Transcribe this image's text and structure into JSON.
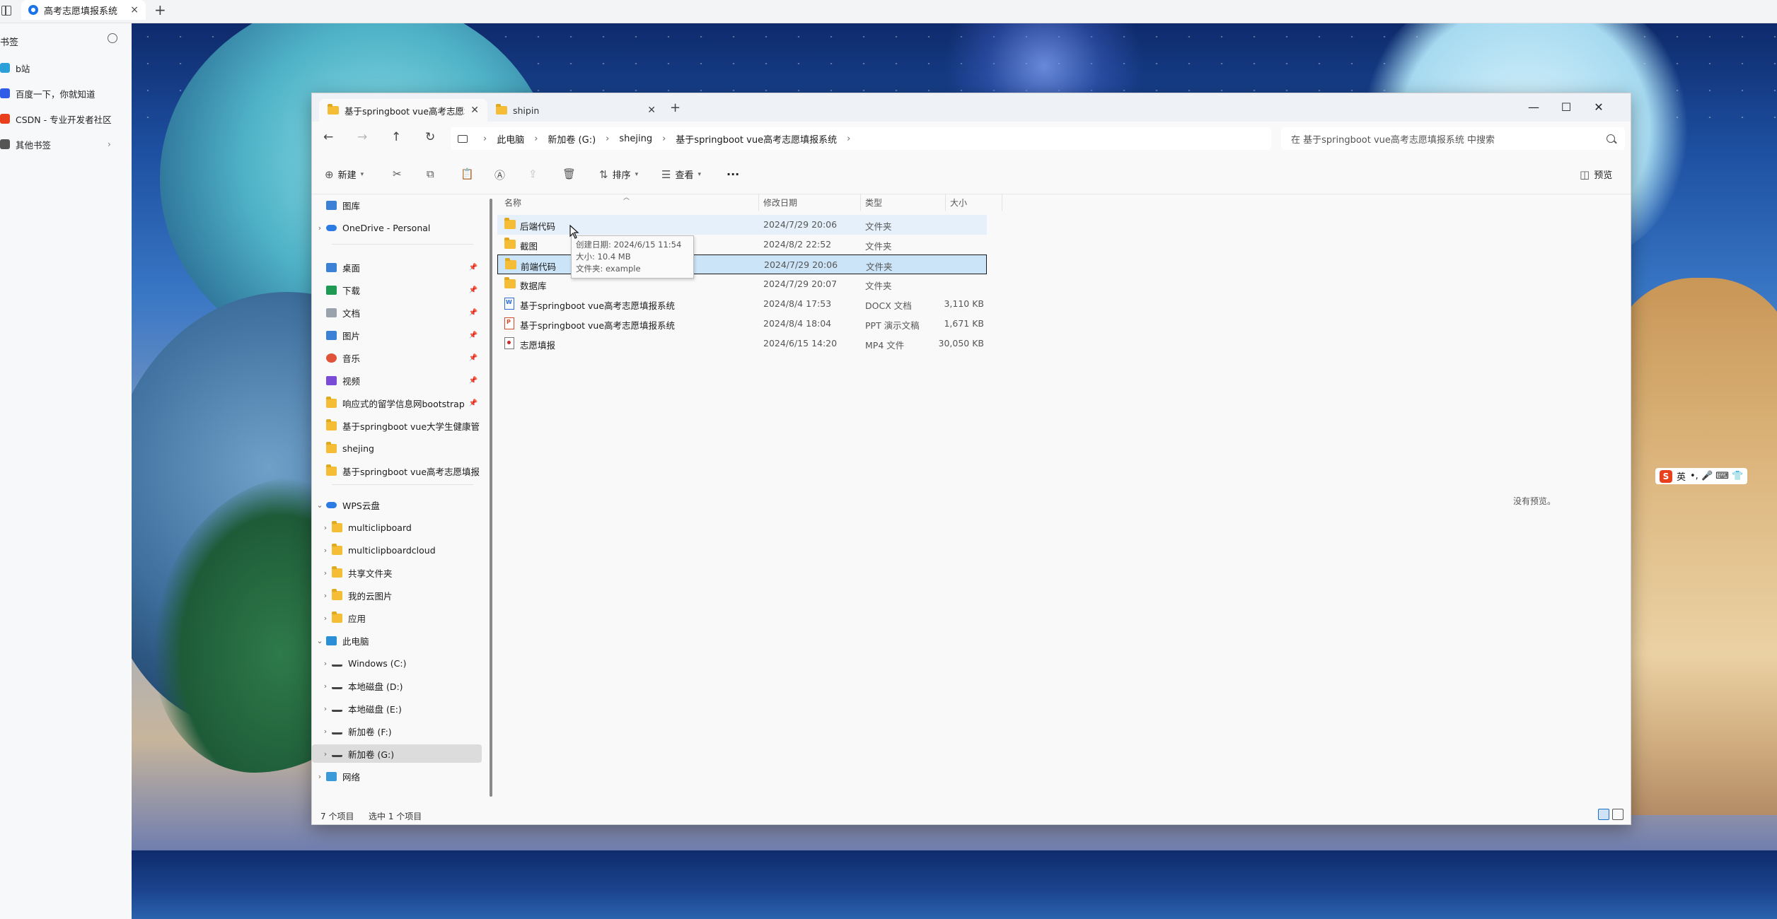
{
  "browser": {
    "tab_title": "高考志愿填报系统",
    "new_tab": "+",
    "tab_close": "×"
  },
  "bookmarks": {
    "header": "书签",
    "items": [
      {
        "label": "b站",
        "icon": "bilibili-icon",
        "color": "#2a9fd8"
      },
      {
        "label": "百度一下，你就知道",
        "icon": "baidu-icon",
        "color": "#2f5ce6"
      },
      {
        "label": "CSDN - 专业开发者社区",
        "icon": "csdn-icon",
        "color": "#e8401c"
      },
      {
        "label": "其他书签",
        "icon": "folder-icon",
        "color": "#555555"
      }
    ]
  },
  "explorer": {
    "tabs": [
      {
        "label": "基于springboot vue高考志愿填"
      },
      {
        "label": "shipin"
      }
    ],
    "window_controls": {
      "minimize": "—",
      "maximize": "☐",
      "close": "✕"
    },
    "breadcrumb": [
      "此电脑",
      "新加卷 (G:)",
      "shejing",
      "基于springboot vue高考志愿填报系统"
    ],
    "search_placeholder": "在 基于springboot vue高考志愿填报系统 中搜索",
    "commands": {
      "new": "新建",
      "sort": "排序",
      "view": "查看",
      "more": "···",
      "preview": "预览"
    },
    "nav_pane": [
      {
        "label": "图库",
        "icon": "gallery-icon",
        "kind": "blue",
        "chev": ""
      },
      {
        "label": "OneDrive - Personal",
        "icon": "onedrive-icon",
        "kind": "cloud",
        "chev": "›"
      },
      {
        "label": "桌面",
        "icon": "desktop-icon",
        "kind": "blue",
        "pin": true
      },
      {
        "label": "下载",
        "icon": "download-icon",
        "kind": "green",
        "pin": true
      },
      {
        "label": "文档",
        "icon": "documents-icon",
        "kind": "gray",
        "pin": true
      },
      {
        "label": "图片",
        "icon": "pictures-icon",
        "kind": "blue",
        "pin": true
      },
      {
        "label": "音乐",
        "icon": "music-icon",
        "kind": "red",
        "pin": true
      },
      {
        "label": "视频",
        "icon": "videos-icon",
        "kind": "purple",
        "pin": true
      },
      {
        "label": "响应式的留学信息网bootstrap",
        "icon": "folder-icon",
        "kind": "folder",
        "pin": true
      },
      {
        "label": "基于springboot vue大学生健康管",
        "icon": "folder-icon",
        "kind": "folder"
      },
      {
        "label": "shejing",
        "icon": "folder-icon",
        "kind": "folder"
      },
      {
        "label": "基于springboot vue高考志愿填报",
        "icon": "folder-icon",
        "kind": "folder"
      },
      {
        "label": "WPS云盘",
        "icon": "wps-cloud-icon",
        "kind": "cloud",
        "chev": "⌄"
      },
      {
        "label": "multiclipboard",
        "icon": "folder-icon",
        "kind": "folder",
        "chev": "›",
        "indent": true
      },
      {
        "label": "multiclipboardcloud",
        "icon": "folder-icon",
        "kind": "folder",
        "chev": "›",
        "indent": true
      },
      {
        "label": "共享文件夹",
        "icon": "folder-icon",
        "kind": "folder",
        "chev": "›",
        "indent": true
      },
      {
        "label": "我的云图片",
        "icon": "folder-icon",
        "kind": "folder",
        "chev": "›",
        "indent": true
      },
      {
        "label": "应用",
        "icon": "folder-icon",
        "kind": "folder",
        "chev": "›",
        "indent": true
      },
      {
        "label": "此电脑",
        "icon": "this-pc-icon",
        "kind": "pc",
        "chev": "⌄"
      },
      {
        "label": "Windows (C:)",
        "icon": "drive-icon",
        "kind": "drive",
        "chev": "›",
        "indent": true
      },
      {
        "label": "本地磁盘 (D:)",
        "icon": "drive-icon",
        "kind": "drive",
        "chev": "›",
        "indent": true
      },
      {
        "label": "本地磁盘 (E:)",
        "icon": "drive-icon",
        "kind": "drive",
        "chev": "›",
        "indent": true
      },
      {
        "label": "新加卷 (F:)",
        "icon": "drive-icon",
        "kind": "drive",
        "chev": "›",
        "indent": true
      },
      {
        "label": "新加卷 (G:)",
        "icon": "drive-icon",
        "kind": "drive",
        "chev": "›",
        "indent": true,
        "selected": true
      },
      {
        "label": "网络",
        "icon": "network-icon",
        "kind": "net",
        "chev": "›"
      }
    ],
    "columns": {
      "name": "名称",
      "date": "修改日期",
      "type": "类型",
      "size": "大小"
    },
    "files": [
      {
        "name": "后端代码",
        "date": "2024/7/29 20:06",
        "type": "文件夹",
        "size": "",
        "kind": "folder",
        "state": "hover"
      },
      {
        "name": "截图",
        "date": "2024/8/2 22:52",
        "type": "文件夹",
        "size": "",
        "kind": "folder",
        "state": ""
      },
      {
        "name": "前端代码",
        "date": "2024/7/29 20:06",
        "type": "文件夹",
        "size": "",
        "kind": "folder",
        "state": "selected"
      },
      {
        "name": "数据库",
        "date": "2024/7/29 20:07",
        "type": "文件夹",
        "size": "",
        "kind": "folder",
        "state": ""
      },
      {
        "name": "基于springboot vue高考志愿填报系统",
        "date": "2024/8/4 17:53",
        "type": "DOCX 文档",
        "size": "3,110 KB",
        "kind": "docx",
        "state": ""
      },
      {
        "name": "基于springboot vue高考志愿填报系统",
        "date": "2024/8/4 18:04",
        "type": "PPT 演示文稿",
        "size": "1,671 KB",
        "kind": "ppt",
        "state": ""
      },
      {
        "name": "志愿填报",
        "date": "2024/6/15 14:20",
        "type": "MP4 文件",
        "size": "30,050 KB",
        "kind": "mp4",
        "state": ""
      }
    ],
    "tooltip": {
      "created": "创建日期: 2024/6/15 11:54",
      "size": "大小: 10.4 MB",
      "folders": "文件夹: example"
    },
    "preview_message": "没有预览。",
    "status": {
      "count": "7 个项目",
      "selected": "选中 1 个项目"
    }
  },
  "ime": {
    "lang": "英",
    "glyphs": "•, 🎤 ⌨ 👕"
  }
}
